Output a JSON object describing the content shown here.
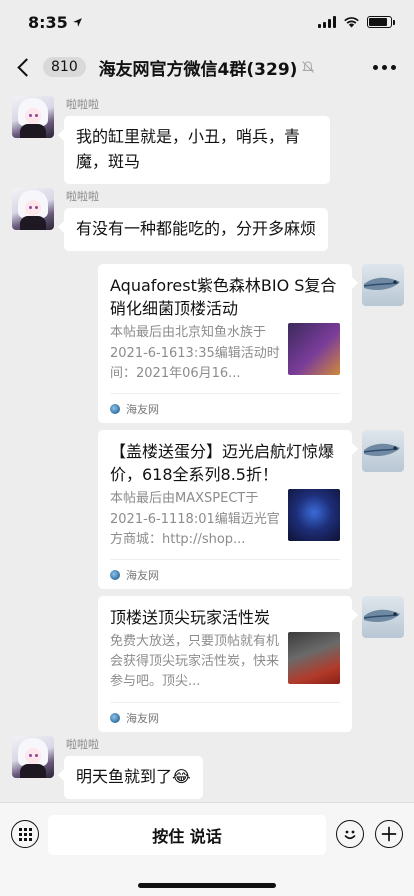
{
  "status": {
    "time": "8:35"
  },
  "header": {
    "unread_count": "810",
    "title": "海友网官方微信4群(329)"
  },
  "messages": [
    {
      "sender": "啦啦啦",
      "text": "我的缸里就是，小丑，哨兵，青魔，斑马"
    },
    {
      "sender": "啦啦啦",
      "text": "有没有一种都能吃的，分开多麻烦"
    },
    {
      "sender": "啦啦啦",
      "text": "明天鱼就到了😂"
    }
  ],
  "cards": [
    {
      "title": "Aquaforest紫色森林BIO S复合硝化细菌顶楼活动",
      "desc": "本帖最后由北京知鱼水族于2021-6-1613:35编辑活动时间：2021年06月16...",
      "source": "海友网"
    },
    {
      "title": "【盖楼送蛋分】迈光启航灯惊爆价，618全系列8.5折！",
      "desc": "本帖最后由MAXSPECT于2021-6-1118:01编辑迈光官方商城：http://shop...",
      "source": "海友网"
    },
    {
      "title": "顶楼送顶尖玩家活性炭",
      "desc": "免费大放送，只要顶帖就有机会获得顶尖玩家活性炭，快来参与吧。顶尖...",
      "source": "海友网"
    }
  ],
  "input_bar": {
    "hold_to_talk": "按住 说话"
  },
  "icons": {
    "location_arrow": "location-arrow-icon",
    "signal": "signal-icon",
    "wifi": "wifi-icon",
    "battery": "battery-icon",
    "back": "back-chevron-icon",
    "mute": "mute-bell-icon",
    "more": "more-dots-icon",
    "keyboard": "keyboard-icon",
    "emoji": "emoji-icon",
    "add": "add-icon",
    "source": "haiyou-logo-icon"
  },
  "colors": {
    "background": "#ededed",
    "bubble": "#ffffff",
    "meta_text": "#8c8c8c"
  }
}
